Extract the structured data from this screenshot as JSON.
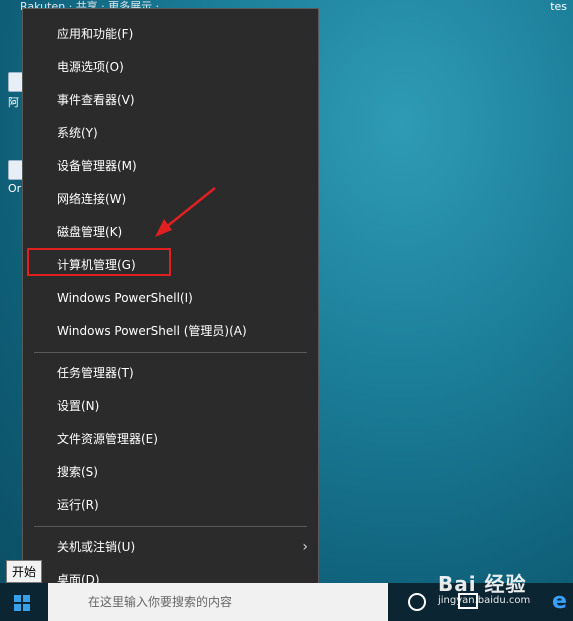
{
  "desktop": {
    "top_text": "Rakuten · 共享 · 更多展示 · ...",
    "corner_text": "tes",
    "icons": [
      {
        "label": "阿"
      },
      {
        "label": "Or Vir"
      }
    ]
  },
  "context_menu": {
    "items": [
      {
        "label": "应用和功能(F)"
      },
      {
        "label": "电源选项(O)"
      },
      {
        "label": "事件查看器(V)"
      },
      {
        "label": "系统(Y)"
      },
      {
        "label": "设备管理器(M)"
      },
      {
        "label": "网络连接(W)"
      },
      {
        "label": "磁盘管理(K)"
      },
      {
        "label": "计算机管理(G)",
        "highlighted": true
      },
      {
        "label": "Windows PowerShell(I)"
      },
      {
        "label": "Windows PowerShell (管理员)(A)"
      },
      {
        "label": "任务管理器(T)"
      },
      {
        "label": "设置(N)"
      },
      {
        "label": "文件资源管理器(E)"
      },
      {
        "label": "搜索(S)"
      },
      {
        "label": "运行(R)"
      },
      {
        "label": "关机或注销(U)",
        "has_submenu": true
      },
      {
        "label": "桌面(D)"
      }
    ]
  },
  "tooltip": {
    "text": "开始"
  },
  "taskbar": {
    "search_placeholder": "在这里输入你要搜索的内容",
    "icons": [
      "windows-start-icon",
      "cortana-icon",
      "task-view-icon",
      "edge-icon"
    ]
  },
  "watermark": {
    "logo": "Bai 经验",
    "url": "jingyan.baidu.com"
  },
  "colors": {
    "menu_bg": "#2b2b2b",
    "highlight": "#e02020",
    "accent": "#38a0e8"
  }
}
